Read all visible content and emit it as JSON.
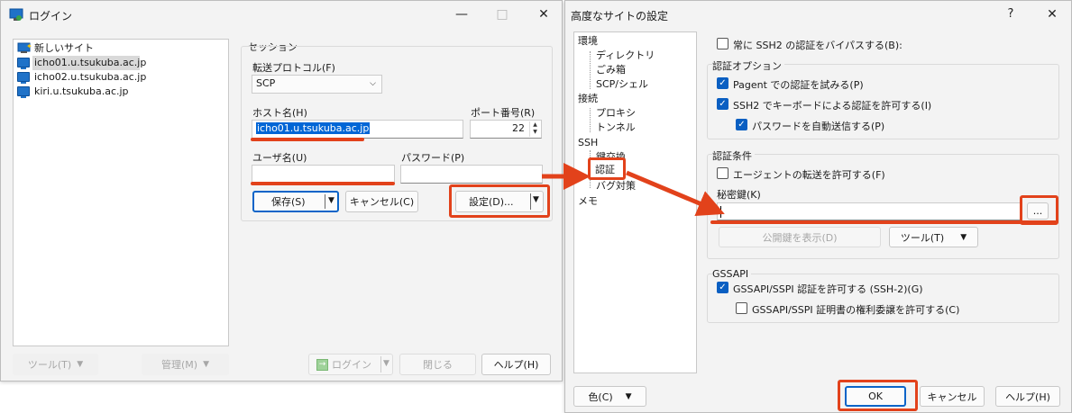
{
  "colors": {
    "accent": "#0a5fc2",
    "highlight": "#e2421b",
    "selection": "#0066d6"
  },
  "login": {
    "title": "ログイン",
    "minimize": "—",
    "maximize": "□",
    "close": "✕",
    "sites": [
      "新しいサイト",
      "icho01.u.tsukuba.ac.jp",
      "icho02.u.tsukuba.ac.jp",
      "kiri.u.tsukuba.ac.jp"
    ],
    "session_label": "セッション",
    "protocol_label": "転送プロトコル(F)",
    "protocol_value": "SCP",
    "host_label": "ホスト名(H)",
    "host_value": "icho01.u.tsukuba.ac.jp",
    "port_label": "ポート番号(R)",
    "port_value": "22",
    "user_label": "ユーザ名(U)",
    "user_value": "",
    "password_label": "パスワード(P)",
    "password_value": "",
    "save_label": "保存(S)",
    "cancel_label": "キャンセル(C)",
    "settings_label": "設定(D)...",
    "tools_label": "ツール(T)",
    "manage_label": "管理(M)",
    "login_label": "ログイン",
    "close_label": "閉じる",
    "help_label": "ヘルプ(H)"
  },
  "advanced": {
    "title": "高度なサイトの設定",
    "help_mark": "?",
    "close": "✕",
    "tree": [
      "環境",
      "ディレクトリ",
      "ごみ箱",
      "SCP/シェル",
      "接続",
      "プロキシ",
      "トンネル",
      "SSH",
      "鍵交換",
      "認証",
      "バグ対策",
      "メモ"
    ],
    "bypass_label": "常に SSH2 の認証をバイパスする(B):",
    "auth_options_title": "認証オプション",
    "pageant_label": "Pagent での認証を試みる(P)",
    "keyboard_label": "SSH2 でキーボードによる認証を許可する(I)",
    "autopass_label": "パスワードを自動送信する(P)",
    "auth_params_title": "認証条件",
    "agent_fwd_label": "エージェントの転送を許可する(F)",
    "private_key_label": "秘密鍵(K)",
    "private_key_value": "",
    "browse_label": "...",
    "show_pubkey_label": "公開鍵を表示(D)",
    "tools_label": "ツール(T)",
    "gssapi_title": "GSSAPI",
    "gssapi_label": "GSSAPI/SSPI 認証を許可する (SSH-2)(G)",
    "gssapi_deleg_label": "GSSAPI/SSPI 証明書の権利委譲を許可する(C)",
    "color_label": "色(C)",
    "ok_label": "OK",
    "cancel_label": "キャンセル",
    "help_label": "ヘルプ(H)"
  }
}
